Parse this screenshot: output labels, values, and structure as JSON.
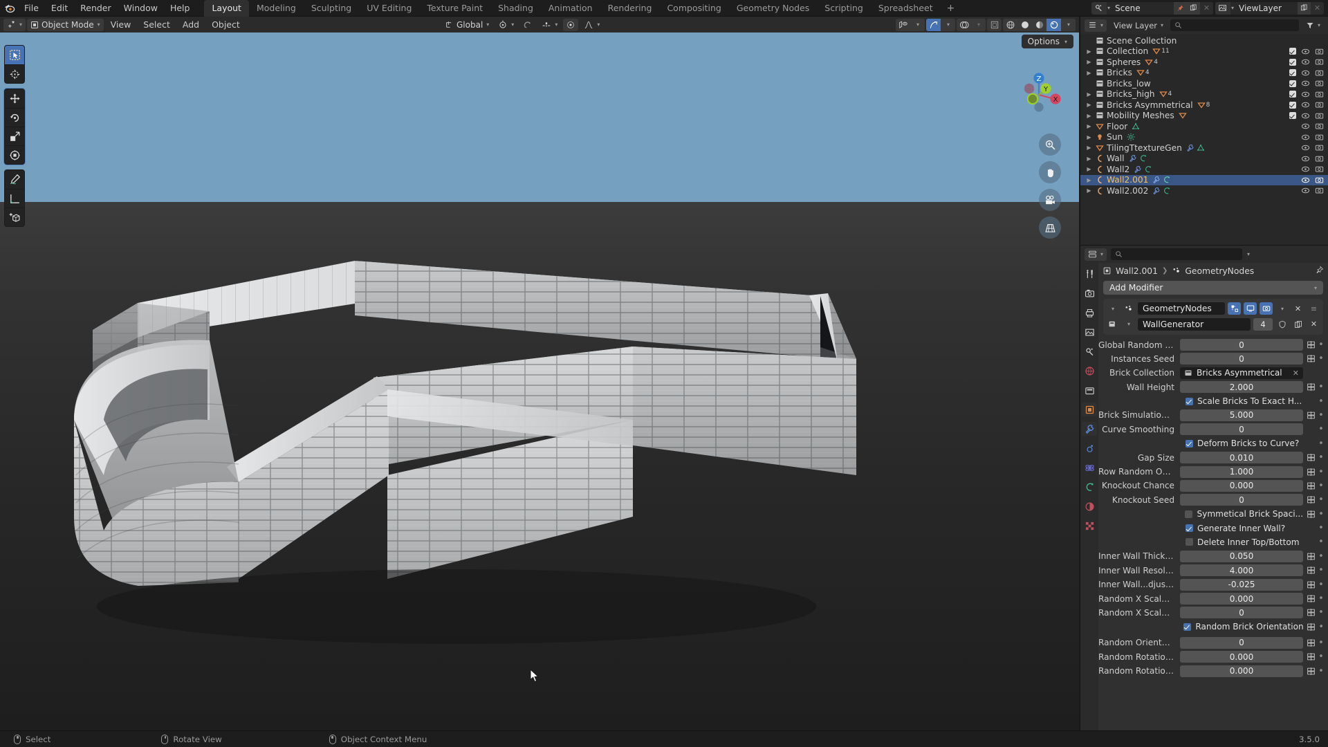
{
  "app": {
    "name": "Blender",
    "version": "3.5.0"
  },
  "topbar": {
    "menus": [
      "File",
      "Edit",
      "Render",
      "Window",
      "Help"
    ],
    "workspace_tabs": [
      {
        "label": "Layout",
        "active": true
      },
      {
        "label": "Modeling",
        "active": false
      },
      {
        "label": "Sculpting",
        "active": false
      },
      {
        "label": "UV Editing",
        "active": false
      },
      {
        "label": "Texture Paint",
        "active": false
      },
      {
        "label": "Shading",
        "active": false
      },
      {
        "label": "Animation",
        "active": false
      },
      {
        "label": "Rendering",
        "active": false
      },
      {
        "label": "Compositing",
        "active": false
      },
      {
        "label": "Geometry Nodes",
        "active": false
      },
      {
        "label": "Scripting",
        "active": false
      },
      {
        "label": "Spreadsheet",
        "active": false
      }
    ],
    "add_workspace_label": "+",
    "scene_name": "Scene",
    "viewlayer_name": "ViewLayer"
  },
  "viewport_header": {
    "mode": "Object Mode",
    "menus": [
      "View",
      "Select",
      "Add",
      "Object"
    ],
    "transform_orientation": "Global",
    "options_label": "Options"
  },
  "outliner": {
    "search_placeholder": "",
    "rows": [
      {
        "name": "Scene Collection",
        "indent": 0,
        "icon": "collection-icon",
        "arrow": false,
        "checkbox": false,
        "eye": false,
        "camera": false,
        "selected": false,
        "tags": []
      },
      {
        "name": "Collection",
        "indent": 1,
        "icon": "collection-icon",
        "arrow": true,
        "checkbox": true,
        "eye": true,
        "camera": true,
        "selected": false,
        "tags": [
          {
            "type": "mesh",
            "count": "11"
          }
        ]
      },
      {
        "name": "Spheres",
        "indent": 1,
        "icon": "collection-icon",
        "arrow": true,
        "checkbox": true,
        "eye": true,
        "camera": true,
        "selected": false,
        "tags": [
          {
            "type": "mesh",
            "count": "4"
          }
        ]
      },
      {
        "name": "Bricks",
        "indent": 1,
        "icon": "collection-icon",
        "arrow": true,
        "checkbox": true,
        "eye": true,
        "camera": true,
        "selected": false,
        "tags": [
          {
            "type": "mesh",
            "count": "4"
          }
        ]
      },
      {
        "name": "Bricks_low",
        "indent": 1,
        "icon": "collection-icon",
        "arrow": false,
        "checkbox": true,
        "eye": true,
        "camera": true,
        "selected": false,
        "tags": []
      },
      {
        "name": "Bricks_high",
        "indent": 1,
        "icon": "collection-icon",
        "arrow": true,
        "checkbox": true,
        "eye": true,
        "camera": true,
        "selected": false,
        "tags": [
          {
            "type": "mesh",
            "count": "4"
          }
        ]
      },
      {
        "name": "Bricks Asymmetrical",
        "indent": 1,
        "icon": "collection-icon",
        "arrow": true,
        "checkbox": true,
        "eye": true,
        "camera": true,
        "selected": false,
        "tags": [
          {
            "type": "mesh",
            "count": "8"
          }
        ]
      },
      {
        "name": "Mobility Meshes",
        "indent": 1,
        "icon": "collection-icon",
        "arrow": true,
        "checkbox": true,
        "eye": true,
        "camera": true,
        "selected": false,
        "tags": [
          {
            "type": "mesh",
            "count": ""
          }
        ]
      },
      {
        "name": "Floor",
        "indent": 1,
        "icon": "mesh-icon",
        "arrow": true,
        "checkbox": false,
        "eye": true,
        "camera": true,
        "selected": false,
        "tags": [
          {
            "type": "meshdata",
            "count": ""
          }
        ]
      },
      {
        "name": "Sun",
        "indent": 1,
        "icon": "light-icon",
        "arrow": true,
        "checkbox": false,
        "eye": true,
        "camera": true,
        "selected": false,
        "tags": [
          {
            "type": "lightdata",
            "count": ""
          }
        ]
      },
      {
        "name": "TilingTtextureGen",
        "indent": 1,
        "icon": "mesh-icon",
        "arrow": true,
        "checkbox": false,
        "eye": true,
        "camera": true,
        "selected": false,
        "tags": [
          {
            "type": "modifier",
            "count": ""
          },
          {
            "type": "meshdata",
            "count": ""
          }
        ]
      },
      {
        "name": "Wall",
        "indent": 1,
        "icon": "curve-icon",
        "arrow": true,
        "checkbox": false,
        "eye": true,
        "camera": true,
        "selected": false,
        "tags": [
          {
            "type": "modifier",
            "count": ""
          },
          {
            "type": "curvedata",
            "count": ""
          }
        ]
      },
      {
        "name": "Wall2",
        "indent": 1,
        "icon": "curve-icon",
        "arrow": true,
        "checkbox": false,
        "eye": true,
        "camera": true,
        "selected": false,
        "tags": [
          {
            "type": "modifier",
            "count": ""
          },
          {
            "type": "curvedata",
            "count": ""
          }
        ]
      },
      {
        "name": "Wall2.001",
        "indent": 1,
        "icon": "curve-icon",
        "arrow": true,
        "checkbox": false,
        "eye": true,
        "camera": true,
        "selected": true,
        "tags": [
          {
            "type": "modifier",
            "count": ""
          },
          {
            "type": "curvedata",
            "count": ""
          }
        ]
      },
      {
        "name": "Wall2.002",
        "indent": 1,
        "icon": "curve-icon",
        "arrow": true,
        "checkbox": false,
        "eye": true,
        "camera": true,
        "selected": false,
        "tags": [
          {
            "type": "modifier",
            "count": ""
          },
          {
            "type": "curvedata",
            "count": ""
          }
        ]
      }
    ]
  },
  "properties": {
    "search_placeholder": "",
    "breadcrumb_object": "Wall2.001",
    "breadcrumb_modifier": "GeometryNodes",
    "add_modifier_label": "Add Modifier",
    "modifier_name": "GeometryNodes",
    "node_group_name": "WallGenerator",
    "node_group_users": "4",
    "params": [
      {
        "label": "Global Random Seed",
        "value": "0",
        "type": "int"
      },
      {
        "label": "Instances Seed",
        "value": "0",
        "type": "int"
      },
      {
        "label": "Brick Collection",
        "value": "Bricks Asymmetrical",
        "type": "collection"
      },
      {
        "label": "Wall Height",
        "value": "2.000",
        "type": "float"
      },
      {
        "label": "Scale Bricks To Exact H...",
        "value": true,
        "type": "checkbox"
      },
      {
        "label": "Brick Simulation Am...",
        "value": "5.000",
        "type": "float"
      },
      {
        "label": "Curve Smoothing",
        "value": "0",
        "type": "int-nospin"
      },
      {
        "label": "Deform Bricks to Curve?",
        "value": true,
        "type": "checkbox-nospin"
      },
      {
        "label": "Gap Size",
        "value": "0.010",
        "type": "float"
      },
      {
        "label": "Row Random Offset",
        "value": "1.000",
        "type": "float"
      },
      {
        "label": "Knockout Chance",
        "value": "0.000",
        "type": "float"
      },
      {
        "label": "Knockout Seed",
        "value": "0",
        "type": "int"
      },
      {
        "label": "Symmetical Brick Spaci...",
        "value": false,
        "type": "checkbox"
      },
      {
        "label": "Generate Inner Wall?",
        "value": true,
        "type": "checkbox-nospin"
      },
      {
        "label": "Delete Inner Top/Bottom",
        "value": false,
        "type": "checkbox-nospin"
      },
      {
        "label": "Inner Wall Thickness",
        "value": "0.050",
        "type": "float"
      },
      {
        "label": "Inner Wall Resolution",
        "value": "4.000",
        "type": "float"
      },
      {
        "label": "Inner Wall...djustment",
        "value": "-0.025",
        "type": "float"
      },
      {
        "label": "Random X Scale Sp...",
        "value": "0.000",
        "type": "float"
      },
      {
        "label": "Random X Scale Seed",
        "value": "0",
        "type": "int"
      },
      {
        "label": "Random Brick Orientation",
        "value": true,
        "type": "checkbox"
      },
      {
        "label": "Random Orientation...",
        "value": "0",
        "type": "int"
      },
      {
        "label": "Random Rotation (Z...",
        "value": "0.000",
        "type": "float"
      },
      {
        "label": "Random Rotation (Y...",
        "value": "0.000",
        "type": "float"
      }
    ]
  },
  "statusbar": {
    "items": [
      {
        "label": "Select",
        "button": "left"
      },
      {
        "label": "Rotate View",
        "button": "middle"
      },
      {
        "label": "Object Context Menu",
        "button": "right"
      }
    ],
    "version": "3.5.0"
  },
  "colors": {
    "accent_blue": "#4772b3",
    "selection_blue": "#3b5787",
    "selected_text": "#f4c16b",
    "sky": "#76a0c0",
    "collection_orange": "#e8a060",
    "mesh_orange": "#e07a3c",
    "mesh_data_green": "#3eb489",
    "modifier_blue": "#6a8fd6"
  }
}
